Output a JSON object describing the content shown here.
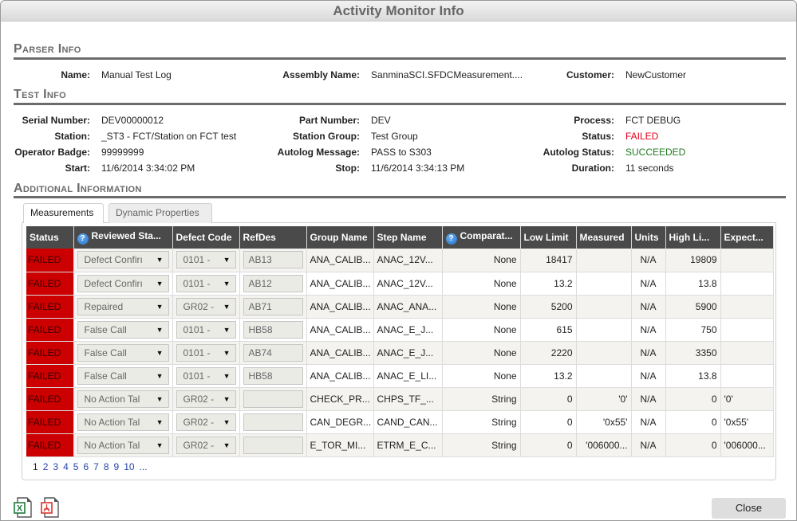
{
  "window": {
    "title": "Activity Monitor Info"
  },
  "parser_info": {
    "title": "Parser Info",
    "fields": [
      {
        "label": "Name:",
        "value": "Manual Test Log"
      },
      {
        "label": "Assembly Name:",
        "value": "SanminaSCI.SFDCMeasurement...."
      },
      {
        "label": "Customer:",
        "value": "NewCustomer"
      }
    ]
  },
  "test_info": {
    "title": "Test Info",
    "col1": [
      {
        "label": "Serial Number:",
        "value": "DEV00000012"
      },
      {
        "label": "Station:",
        "value": "_ST3 - FCT/Station on FCT test"
      },
      {
        "label": "Operator Badge:",
        "value": "99999999"
      },
      {
        "label": "Start:",
        "value": "11/6/2014 3:34:02 PM"
      }
    ],
    "col2": [
      {
        "label": "Part Number:",
        "value": "DEV"
      },
      {
        "label": "Station Group:",
        "value": "Test Group"
      },
      {
        "label": "Autolog Message:",
        "value": "PASS to S303"
      },
      {
        "label": "Stop:",
        "value": "11/6/2014 3:34:13 PM"
      }
    ],
    "col3": [
      {
        "label": "Process:",
        "value": "FCT DEBUG"
      },
      {
        "label": "Status:",
        "value": "FAILED"
      },
      {
        "label": "Autolog Status:",
        "value": "SUCCEEDED"
      },
      {
        "label": "Duration:",
        "value": "11 seconds"
      }
    ]
  },
  "additional_info": {
    "title": "Additional Information",
    "tabs": [
      {
        "label": "Measurements",
        "active": true
      },
      {
        "label": "Dynamic Properties",
        "active": false
      }
    ]
  },
  "table": {
    "columns": [
      "Status",
      "Reviewed Sta...",
      "Defect Code",
      "RefDes",
      "Group Name",
      "Step Name",
      "Comparat...",
      "Low Limit",
      "Measured",
      "Units",
      "High Li...",
      "Expect..."
    ],
    "rows": [
      {
        "status": "FAILED",
        "reviewed": "Defect Confirı",
        "defect": "0101 -",
        "refdes": "AB13",
        "group": "ANA_CALIB...",
        "step": "ANAC_12V...",
        "comp": "None",
        "low": "18417",
        "measured": "",
        "units": "N/A",
        "high": "19809",
        "expected": ""
      },
      {
        "status": "FAILED",
        "reviewed": "Defect Confirı",
        "defect": "0101 -",
        "refdes": "AB12",
        "group": "ANA_CALIB...",
        "step": "ANAC_12V...",
        "comp": "None",
        "low": "13.2",
        "measured": "",
        "units": "N/A",
        "high": "13.8",
        "expected": ""
      },
      {
        "status": "FAILED",
        "reviewed": "Repaired",
        "defect": "GR02 -",
        "refdes": "AB71",
        "group": "ANA_CALIB...",
        "step": "ANAC_ANA...",
        "comp": "None",
        "low": "5200",
        "measured": "",
        "units": "N/A",
        "high": "5900",
        "expected": ""
      },
      {
        "status": "FAILED",
        "reviewed": "False Call",
        "defect": "0101 -",
        "refdes": "HB58",
        "group": "ANA_CALIB...",
        "step": "ANAC_E_J...",
        "comp": "None",
        "low": "615",
        "measured": "",
        "units": "N/A",
        "high": "750",
        "expected": ""
      },
      {
        "status": "FAILED",
        "reviewed": "False Call",
        "defect": "0101 -",
        "refdes": "AB74",
        "group": "ANA_CALIB...",
        "step": "ANAC_E_J...",
        "comp": "None",
        "low": "2220",
        "measured": "",
        "units": "N/A",
        "high": "3350",
        "expected": ""
      },
      {
        "status": "FAILED",
        "reviewed": "False Call",
        "defect": "0101 -",
        "refdes": "HB58",
        "group": "ANA_CALIB...",
        "step": "ANAC_E_LI...",
        "comp": "None",
        "low": "13.2",
        "measured": "",
        "units": "N/A",
        "high": "13.8",
        "expected": ""
      },
      {
        "status": "FAILED",
        "reviewed": "No Action Tal",
        "defect": "GR02 -",
        "refdes": "",
        "group": "CHECK_PR...",
        "step": "CHPS_TF_...",
        "comp": "String",
        "low": "0",
        "measured": "'0'",
        "units": "N/A",
        "high": "0",
        "expected": "'0'"
      },
      {
        "status": "FAILED",
        "reviewed": "No Action Tal",
        "defect": "GR02 -",
        "refdes": "",
        "group": "CAN_DEGR...",
        "step": "CAND_CAN...",
        "comp": "String",
        "low": "0",
        "measured": "'0x55'",
        "units": "N/A",
        "high": "0",
        "expected": "'0x55'"
      },
      {
        "status": "FAILED",
        "reviewed": "No Action Tal",
        "defect": "GR02 -",
        "refdes": "",
        "group": "E_TOR_MI...",
        "step": "ETRM_E_C...",
        "comp": "String",
        "low": "0",
        "measured": "'006000...",
        "units": "N/A",
        "high": "0",
        "expected": "'006000..."
      }
    ]
  },
  "pager": {
    "pages": [
      "1",
      "2",
      "3",
      "4",
      "5",
      "6",
      "7",
      "8",
      "9",
      "10",
      "..."
    ],
    "current": "1"
  },
  "footer": {
    "export_icons": [
      "excel-icon",
      "pdf-icon"
    ],
    "close_label": "Close"
  },
  "colors": {
    "failed": "#e0001b",
    "succeeded": "#1f7a1f",
    "status_cell": "#cc0000",
    "header": "#4a4a4a"
  }
}
